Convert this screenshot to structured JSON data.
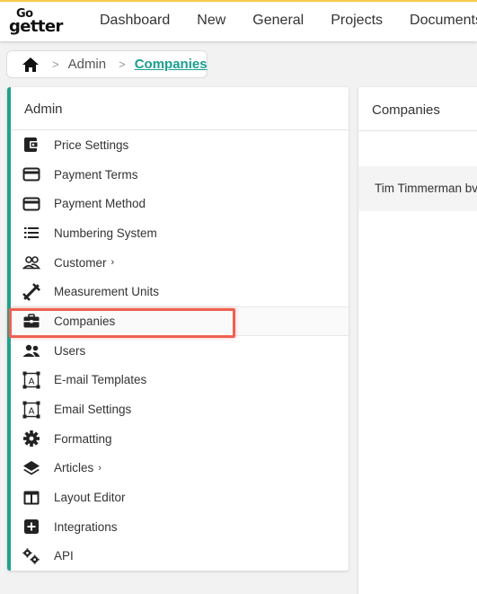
{
  "app": {
    "logo_top": "Go",
    "logo_bottom": "getter"
  },
  "nav": {
    "items": [
      "Dashboard",
      "New",
      "General",
      "Projects",
      "Documents"
    ]
  },
  "breadcrumb": {
    "home_icon": "home-icon",
    "items": [
      "Admin",
      "Companies"
    ]
  },
  "admin": {
    "title": "Admin",
    "items": [
      {
        "label": "Price Settings",
        "icon": "wallet-icon"
      },
      {
        "label": "Payment Terms",
        "icon": "credit-card-icon"
      },
      {
        "label": "Payment Method",
        "icon": "credit-card-icon"
      },
      {
        "label": "Numbering System",
        "icon": "list-icon"
      },
      {
        "label": "Customer",
        "icon": "people-outline-icon",
        "chevron": "›"
      },
      {
        "label": "Measurement Units",
        "icon": "ruler-icon"
      },
      {
        "label": "Companies",
        "icon": "briefcase-icon",
        "active": true
      },
      {
        "label": "Users",
        "icon": "people-icon"
      },
      {
        "label": "E-mail Templates",
        "icon": "text-box-icon"
      },
      {
        "label": "Email Settings",
        "icon": "text-box-icon"
      },
      {
        "label": "Formatting",
        "icon": "gear-icon"
      },
      {
        "label": "Articles",
        "icon": "layers-icon",
        "chevron": "›"
      },
      {
        "label": "Layout Editor",
        "icon": "layout-icon"
      },
      {
        "label": "Integrations",
        "icon": "plus-box-icon"
      },
      {
        "label": "API",
        "icon": "gears-icon"
      }
    ]
  },
  "companies": {
    "title": "Companies",
    "rows": [
      "Tim Timmerman bv"
    ]
  },
  "colors": {
    "accent": "#1a9e8f",
    "highlight": "#f06050",
    "topbar_border": "#f5c94a"
  }
}
